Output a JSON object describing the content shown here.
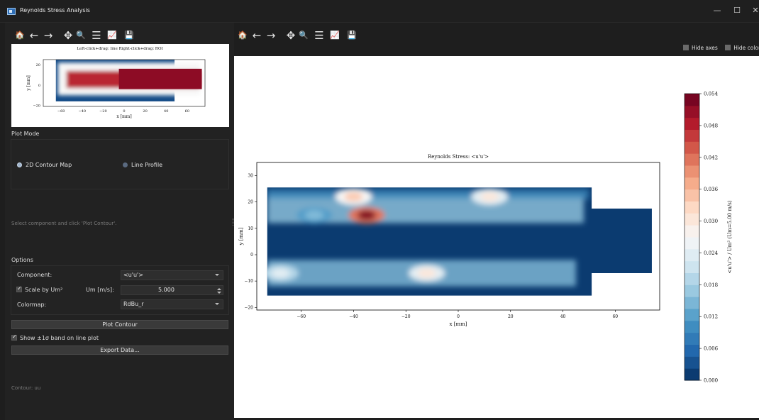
{
  "window": {
    "title": "Reynolds Stress Analysis",
    "minimize": "—",
    "maximize": "☐",
    "close": "✕"
  },
  "toolbar_icons": [
    "home-icon",
    "back-icon",
    "forward-icon",
    "pan-icon",
    "zoom-icon",
    "configure-icon",
    "axes-edit-icon",
    "save-icon"
  ],
  "toolbar_glyphs": {
    "home-icon": "🏠",
    "back-icon": "←",
    "forward-icon": "→",
    "pan-icon": "✥",
    "zoom-icon": "🔍",
    "configure-icon": "☰",
    "axes-edit-icon": "📈",
    "save-icon": "💾"
  },
  "mini_plot": {
    "header": "Left-click+drag: line    Right-click+drag: ROI",
    "xlabel": "x [mm]",
    "ylabel": "y [mm]",
    "xticks": [
      "−60",
      "−40",
      "−20",
      "0",
      "20",
      "40",
      "60"
    ],
    "yticks": [
      "20",
      "0",
      "−20"
    ]
  },
  "plot_mode": {
    "section_title": "Plot Mode",
    "option_contour": "2D Contour Map",
    "option_line": "Line Profile",
    "selected": "2D Contour Map"
  },
  "hint_text": "Select component and click 'Plot Contour'.",
  "options": {
    "section_title": "Options",
    "component_label": "Component:",
    "component_value": "<u'u'>",
    "scale_label": "Scale by Um²",
    "scale_checked": true,
    "um_label": "Um [m/s]:",
    "um_value": "5.000",
    "colormap_label": "Colormap:",
    "colormap_value": "RdBu_r"
  },
  "buttons": {
    "plot_contour": "Plot Contour",
    "export": "Export Data..."
  },
  "band_label": "Show ±1σ band on line plot",
  "band_checked": true,
  "status_text": "Contour: uu",
  "hide_axes_label": "Hide axes",
  "hide_colorbar_label": "Hide colorba",
  "chart_data": {
    "type": "heatmap",
    "title": "Reynolds Stress: <u'u'>",
    "xlabel": "x [mm]",
    "ylabel": "y [mm]",
    "xlim": [
      -77,
      77
    ],
    "ylim": [
      -21,
      35
    ],
    "xticks": [
      -60,
      -40,
      -20,
      0,
      20,
      40,
      60
    ],
    "yticks": [
      -20,
      -10,
      0,
      10,
      20,
      30
    ],
    "colormap": "RdBu_r",
    "colorbar_label": "<u'u'> / Um² (Um=5.00 m/s)",
    "colorbar_range": [
      0.0,
      0.054
    ],
    "colorbar_ticks": [
      0.0,
      0.006,
      0.012,
      0.018,
      0.024,
      0.03,
      0.036,
      0.042,
      0.048,
      0.054
    ],
    "colorbar_tick_labels": [
      "0.000",
      "0.006",
      "0.012",
      "0.018",
      "0.024",
      "0.030",
      "0.036",
      "0.042",
      "0.048",
      "0.054"
    ],
    "domain": {
      "x": [
        -73,
        74
      ],
      "y": [
        -15.5,
        25.5
      ]
    },
    "hotspots": [
      {
        "x": -35,
        "y": 15,
        "value": 0.052
      },
      {
        "x": -40,
        "y": 22,
        "value": 0.034
      },
      {
        "x": 12,
        "y": 22,
        "value": 0.03
      },
      {
        "x": -12,
        "y": -7,
        "value": 0.03
      },
      {
        "x": -68,
        "y": -7,
        "value": 0.024
      },
      {
        "x": -55,
        "y": 15,
        "value": 0.015
      }
    ]
  }
}
